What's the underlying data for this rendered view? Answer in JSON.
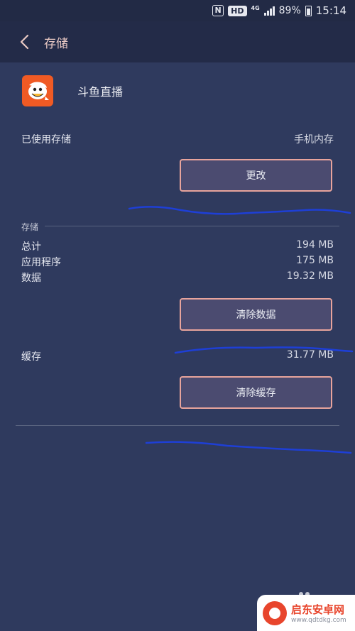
{
  "status_bar": {
    "nfc": "N",
    "hd": "HD",
    "network": "4G",
    "battery": "89%",
    "time": "15:14"
  },
  "app_bar": {
    "title": "存储",
    "back_icon": "chevron-left-icon"
  },
  "app": {
    "name": "斗鱼直播",
    "icon": "douyu-fish-icon",
    "icon_color": "#f05a24"
  },
  "used_storage": {
    "label": "已使用存储",
    "value": "手机内存",
    "change_button": "更改"
  },
  "storage": {
    "section_label": "存储",
    "rows": [
      {
        "label": "总计",
        "value": "194 MB"
      },
      {
        "label": "应用程序",
        "value": "175 MB"
      },
      {
        "label": "数据",
        "value": "19.32 MB"
      }
    ],
    "clear_data_button": "清除数据"
  },
  "cache": {
    "label": "缓存",
    "value": "31.77 MB",
    "clear_cache_button": "清除缓存"
  },
  "watermark": {
    "title": "启东安卓网",
    "url": "www.qdtdkg.com"
  },
  "colors": {
    "background": "#2f3a5e",
    "app_bar": "#232b48",
    "accent": "#e8a49c",
    "button_fill": "#4b4b70",
    "scribble": "#1e3fd6"
  }
}
